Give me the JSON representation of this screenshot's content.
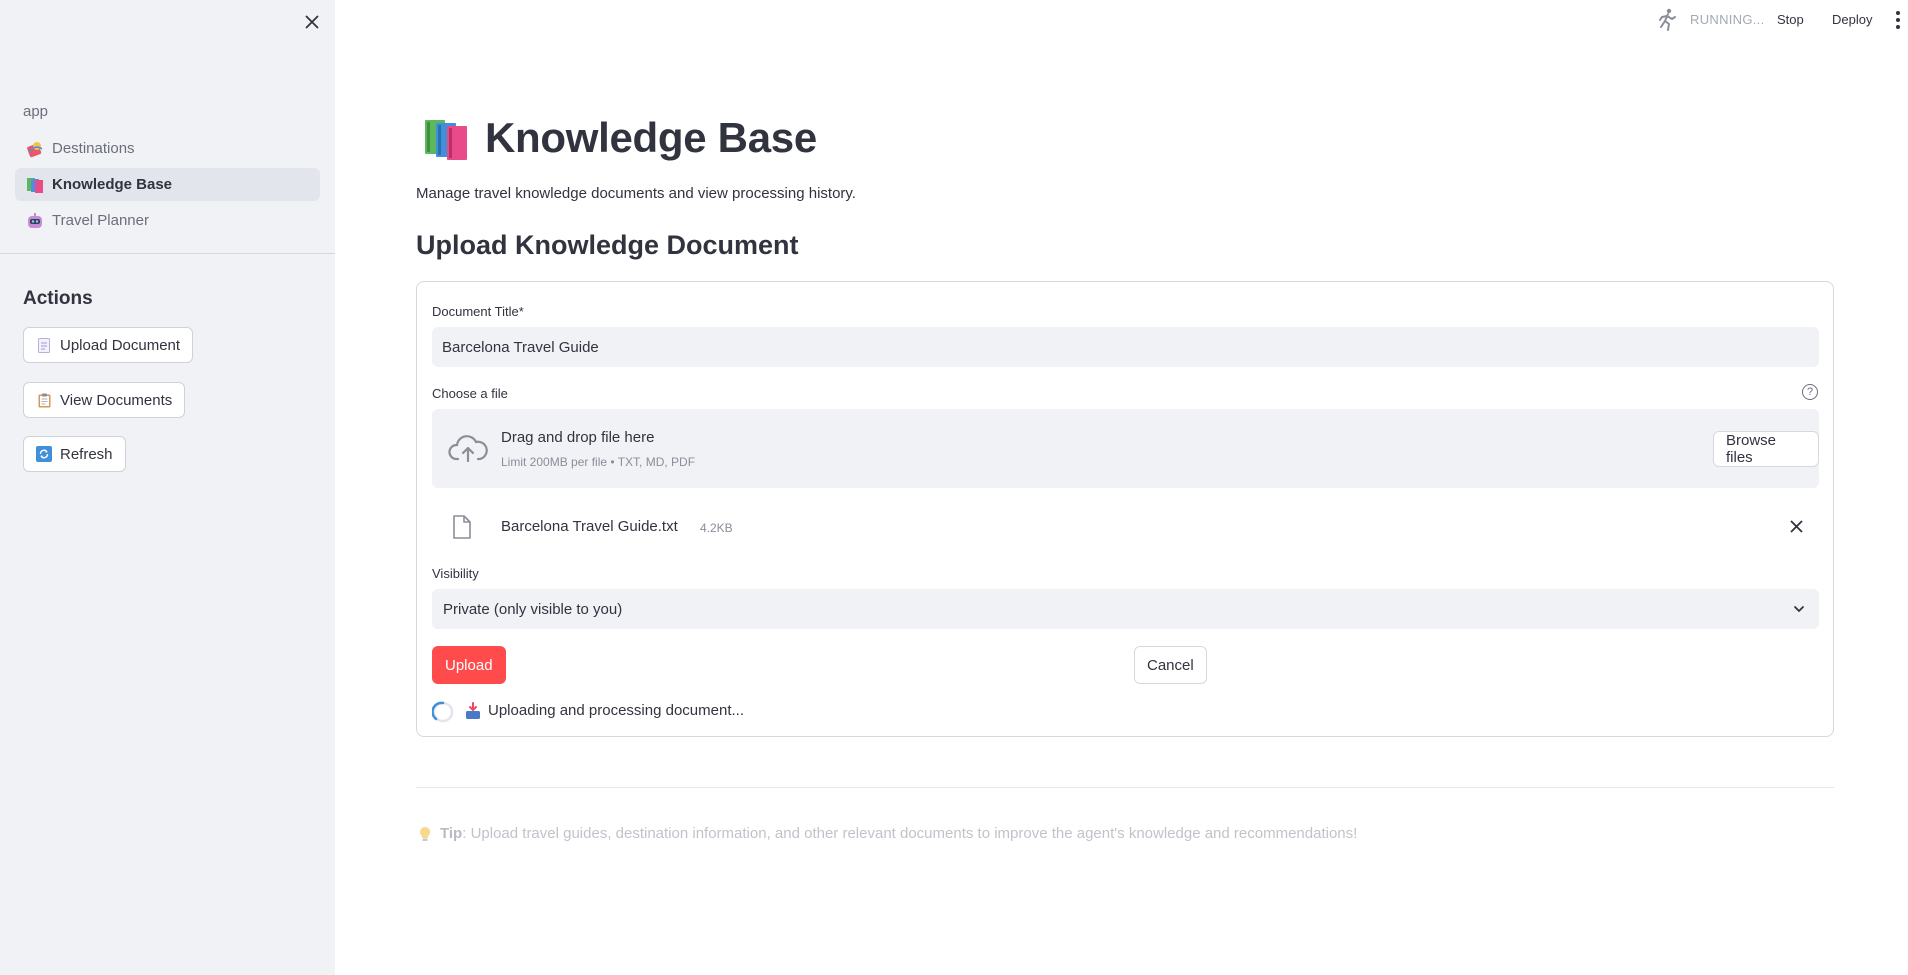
{
  "sidebar": {
    "app_label": "app",
    "nav_items": [
      {
        "label": "Destinations",
        "icon": "passport-icon",
        "active": false
      },
      {
        "label": "Knowledge Base",
        "icon": "books-icon",
        "active": true
      },
      {
        "label": "Travel Planner",
        "icon": "robot-icon",
        "active": false
      }
    ],
    "actions_title": "Actions",
    "actions": [
      {
        "label": "Upload Document",
        "icon": "page-icon"
      },
      {
        "label": "View Documents",
        "icon": "clipboard-icon"
      },
      {
        "label": "Refresh",
        "icon": "arrows-cycle-icon"
      }
    ]
  },
  "topbar": {
    "status": "RUNNING...",
    "stop_label": "Stop",
    "deploy_label": "Deploy"
  },
  "main": {
    "title": "Knowledge Base",
    "subtitle": "Manage travel knowledge documents and view processing history.",
    "section_title": "Upload Knowledge Document",
    "form": {
      "doc_title_label": "Document Title*",
      "doc_title_value": "Barcelona Travel Guide",
      "file_label": "Choose a file",
      "dropzone_main": "Drag and drop file here",
      "dropzone_sub": "Limit 200MB per file • TXT, MD, PDF",
      "browse_label": "Browse files",
      "uploaded_file_name": "Barcelona Travel Guide.txt",
      "uploaded_file_size": "4.2KB",
      "visibility_label": "Visibility",
      "visibility_value": "Private (only visible to you)",
      "upload_label": "Upload",
      "cancel_label": "Cancel",
      "processing_text": "Uploading and processing document..."
    },
    "tip_prefix": "Tip",
    "tip_text": ": Upload travel guides, destination information, and other relevant documents to improve the agent's knowledge and recommendations!"
  },
  "colors": {
    "primary": "#ff4b4b",
    "sidebar_bg": "#f0f2f6",
    "text": "#31333f",
    "muted": "#6b6f7b"
  }
}
